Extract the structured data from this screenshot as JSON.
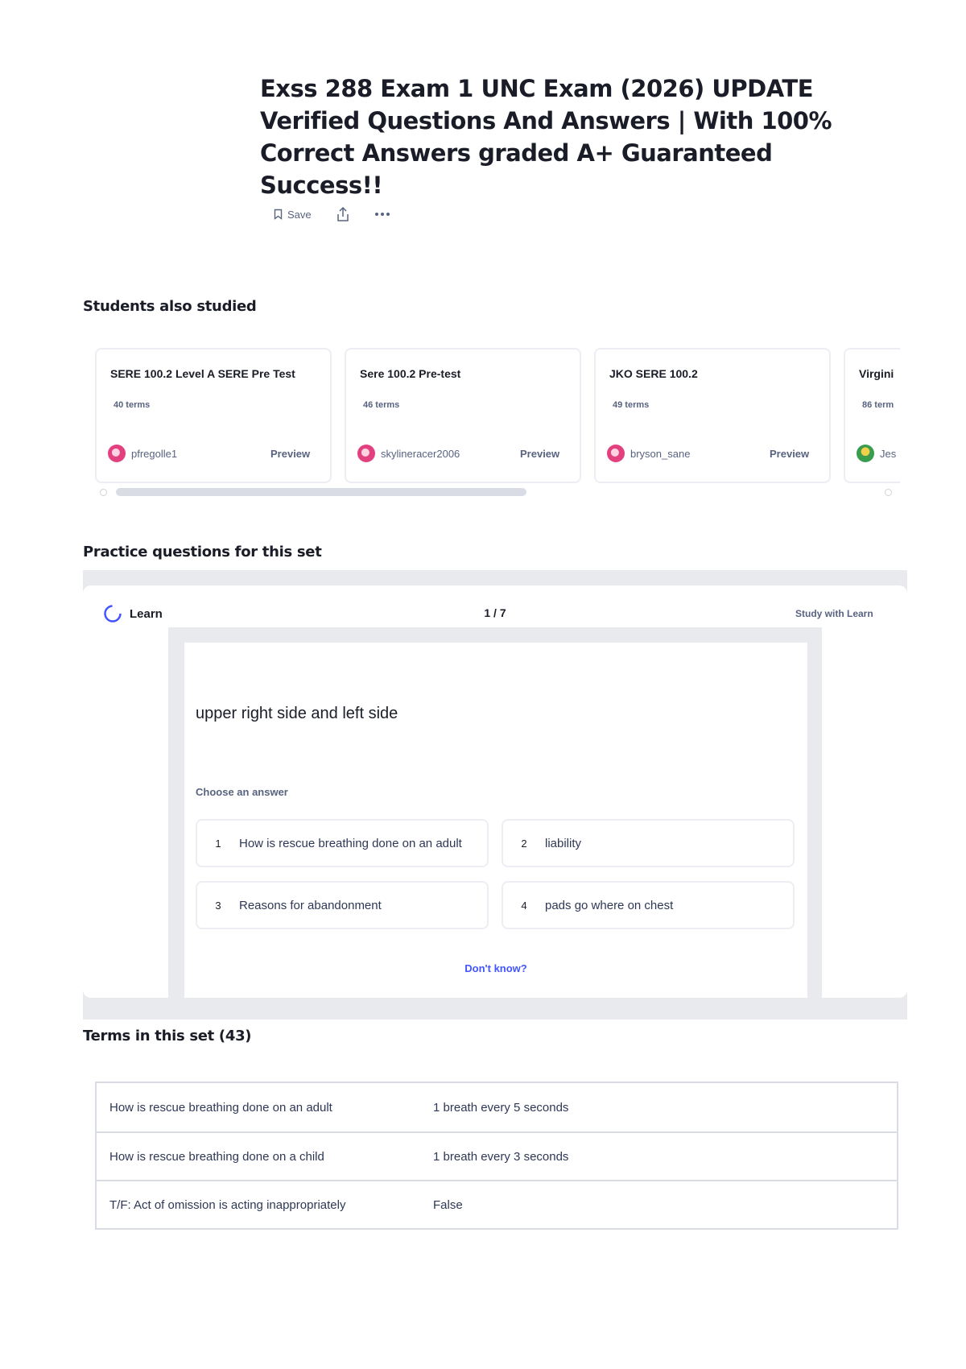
{
  "header": {
    "title": "Exss 288 Exam 1 UNC Exam (2026) UPDATE Verified Questions And Answers | With 100% Correct Answers graded A+ Guaranteed Success!!",
    "save_label": "Save"
  },
  "students_also_studied": {
    "heading": "Students also studied",
    "cards": [
      {
        "title": "SERE 100.2 Level A SERE Pre Test",
        "terms": "40 terms",
        "user": "pfregolle1",
        "preview": "Preview",
        "avatar": "pink"
      },
      {
        "title": "Sere 100.2 Pre-test",
        "terms": "46 terms",
        "user": "skylineracer2006",
        "preview": "Preview",
        "avatar": "pink"
      },
      {
        "title": "JKO SERE 100.2",
        "terms": "49 terms",
        "user": "bryson_sane",
        "preview": "Preview",
        "avatar": "pink"
      },
      {
        "title": "Virgini",
        "terms": "86 term",
        "user": "Jes",
        "preview": "",
        "avatar": "green"
      }
    ]
  },
  "practice": {
    "heading": "Practice questions for this set",
    "learn_label": "Learn",
    "counter": "1 / 7",
    "study_with_learn": "Study with Learn",
    "prompt": "upper right side and left side",
    "choose_label": "Choose an answer",
    "options": [
      {
        "num": "1",
        "text": "How is rescue breathing done on an adult"
      },
      {
        "num": "2",
        "text": "liability"
      },
      {
        "num": "3",
        "text": "Reasons for abandonment"
      },
      {
        "num": "4",
        "text": "pads go where on chest"
      }
    ],
    "dont_know": "Don't know?"
  },
  "terms": {
    "heading": "Terms in this set (43)",
    "rows": [
      {
        "term": "How is rescue breathing done on an adult",
        "definition": "1 breath every 5 seconds"
      },
      {
        "term": "How is rescue breathing done on a child",
        "definition": "1 breath every 3 seconds"
      },
      {
        "term": "T/F: Act of omission is acting inappropriately",
        "definition": "False"
      }
    ]
  },
  "colors": {
    "text_primary": "#1a1d28",
    "text_secondary": "#586380",
    "link_blue": "#4255ff",
    "panel_gray": "#e9eaee"
  }
}
